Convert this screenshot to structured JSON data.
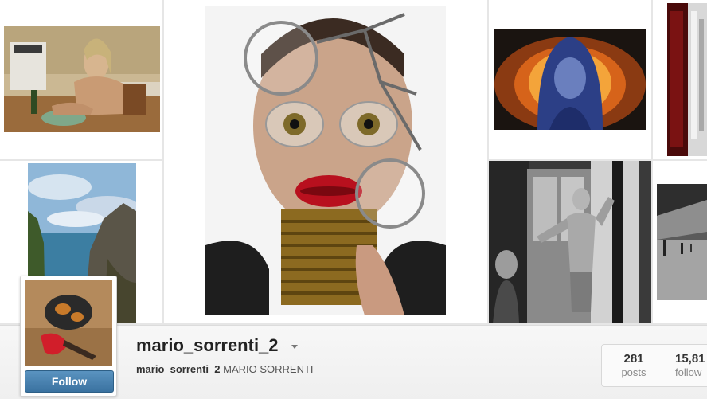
{
  "profile": {
    "username": "mario_sorrenti_2",
    "bio_handle": "mario_sorrenti_2",
    "bio_name": "MARIO SORRENTI",
    "follow_label": "Follow"
  },
  "stats": [
    {
      "value": "281",
      "label": "posts"
    },
    {
      "value": "15,81",
      "label": "follow"
    }
  ],
  "photos": [
    "photo-man-at-kitchen-table",
    "photo-magnifier-portrait",
    "photo-blue-hair-fire",
    "photo-red-interior",
    "photo-coastal-cliffs",
    "photo-boy-by-window",
    "photo-gallery-corridor"
  ],
  "colors": {
    "follow_button": "#4a84b3",
    "username": "#222222",
    "bar_background": "#f2f2f2"
  }
}
